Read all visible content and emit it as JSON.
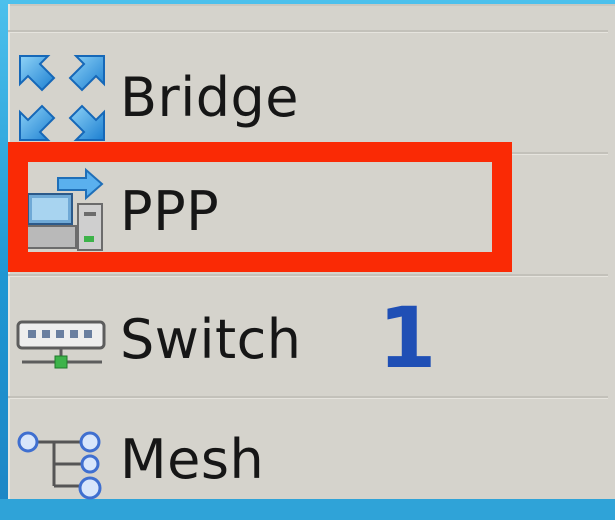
{
  "menu": {
    "items": [
      {
        "id": "bridge",
        "label": "Bridge",
        "icon": "bridge-icon"
      },
      {
        "id": "ppp",
        "label": "PPP",
        "icon": "ppp-icon"
      },
      {
        "id": "switch",
        "label": "Switch",
        "icon": "switch-icon"
      },
      {
        "id": "mesh",
        "label": "Mesh",
        "icon": "mesh-icon"
      }
    ]
  },
  "annotation": {
    "highlight_target": "ppp",
    "step_number": "1",
    "highlight_color": "#fa2a05",
    "number_color": "#1f4fb5"
  },
  "colors": {
    "background": "#2fa3d8",
    "panel": "#d5d3cc",
    "text": "#161616"
  }
}
